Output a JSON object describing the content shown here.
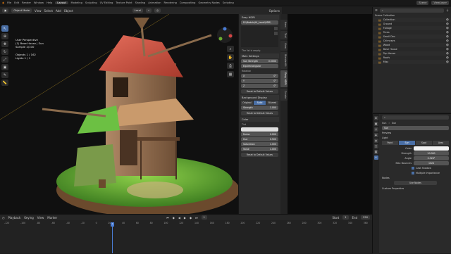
{
  "topbar": {
    "menus": [
      "File",
      "Edit",
      "Render",
      "Window",
      "Help"
    ],
    "workspaces": [
      "Layout",
      "Modeling",
      "Sculpting",
      "UV Editing",
      "Texture Paint",
      "Shading",
      "Animation",
      "Rendering",
      "Compositing",
      "Geometry Nodes",
      "Scripting"
    ],
    "scene": "Scene",
    "view_layer": "ViewLayer"
  },
  "viewport_header": {
    "mode": "Object Mode",
    "menus": [
      "View",
      "Select",
      "Add",
      "Object"
    ],
    "transform": "Local",
    "options": "Options"
  },
  "viewport_info": [
    "User Perspective",
    "(1) Base House | Sun",
    "Sample 2/100",
    "",
    "Objects     1 / 162",
    "Lights       1 / 1"
  ],
  "npanel": {
    "title": "Easy HDRI",
    "file": "D:\\Models\\Hi_Level\\HDR\\",
    "empty_msg": "The list is empty.",
    "main_settings": "Main Settings",
    "sun_strength_label": "Sun Strength",
    "sun_strength": "0.5000",
    "projection": "Equirectangular",
    "rotation_label": "Rotation",
    "rot_x_label": "X",
    "rot_x": "0°",
    "rot_y_label": "Y",
    "rot_y": "0°",
    "rot_z_label": "Z",
    "rot_z": "0°",
    "reset": "Reset to Default Values",
    "background_display": "Background Display",
    "bg_modes": [
      "Original",
      "Solid",
      "Blurred"
    ],
    "strength_label": "Strength",
    "strength": "1.000",
    "color_section": "Color",
    "tint_label": "Tint",
    "factor_label": "Factor",
    "factor": "0.000",
    "hue_label": "Hue",
    "hue": "0.500",
    "saturation_label": "Saturation",
    "saturation": "1.000",
    "value_label": "Value",
    "value": "1.000"
  },
  "vtabs": [
    "Item",
    "Tool",
    "View",
    "BlenderKit",
    "Easy HDRI",
    "Create"
  ],
  "timeline": {
    "menus": [
      "Playback",
      "Keying",
      "View",
      "Marker"
    ],
    "current_frame": "1",
    "start_label": "Start",
    "start": "1",
    "end_label": "End",
    "end": "250",
    "ticks": [
      "-120",
      "-100",
      "-80",
      "-60",
      "-40",
      "-20",
      "0",
      "20",
      "40",
      "60",
      "80",
      "100",
      "120",
      "140",
      "160",
      "180",
      "200",
      "220",
      "240",
      "260",
      "280",
      "300",
      "320",
      "340",
      "360"
    ]
  },
  "outliner": {
    "title": "Scene Collection",
    "items": [
      "Collection",
      "Ground",
      "Foliage",
      "Trees",
      "Small Dec",
      "Chimneys",
      "Wood",
      "Base House",
      "Top House",
      "Roofs",
      "Misc"
    ]
  },
  "properties": {
    "object": "Sun",
    "data": "Sun",
    "preview": "Preview",
    "light_section": "Light",
    "light_types": [
      "Point",
      "Sun",
      "Spot",
      "Area"
    ],
    "color_label": "Color",
    "strength_label": "Strength",
    "strength": "10.000",
    "angle_label": "Angle",
    "angle": "0.526°",
    "max_bounces_label": "Max Bounces",
    "max_bounces": "1024",
    "cast_shadow": "Cast Shadow",
    "multiple_importance": "Multiple Importance",
    "nodes_section": "Nodes",
    "use_nodes": "Use Nodes",
    "custom_props": "Custom Properties"
  },
  "colors": {
    "accent": "#4a6fa5",
    "outliner_icon": "#e3a030"
  }
}
